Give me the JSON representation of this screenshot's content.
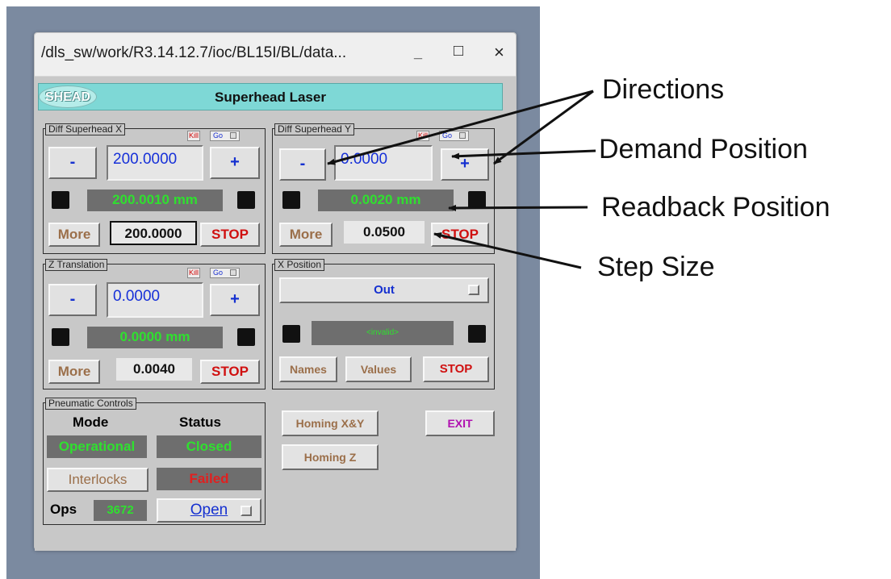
{
  "window": {
    "title": "/dls_sw/work/R3.14.12.7/ioc/BL15I/BL/data...",
    "minimize": "_",
    "maximize": "□",
    "close": "×"
  },
  "header": {
    "logo": "SHEAD",
    "title": "Superhead Laser"
  },
  "diff_x": {
    "label": "Diff Superhead X",
    "kill": "Kill",
    "go": "Go",
    "minus": "-",
    "plus": "+",
    "demand": "200.0000",
    "readback": "200.0010 mm",
    "more": "More",
    "step": "200.0000",
    "stop": "STOP"
  },
  "diff_y": {
    "label": "Diff Superhead Y",
    "kill": "Kill",
    "go": "Go",
    "minus": "-",
    "plus": "+",
    "demand": "0.0000",
    "readback": "0.0020 mm",
    "more": "More",
    "step": "0.0500",
    "stop": "STOP"
  },
  "z_trans": {
    "label": "Z Translation",
    "kill": "Kill",
    "go": "Go",
    "minus": "-",
    "plus": "+",
    "demand": "0.0000",
    "readback": "0.0000 mm",
    "more": "More",
    "step": "0.0040",
    "stop": "STOP"
  },
  "x_position": {
    "label": "X Position",
    "select": "Out",
    "readback": "<invalid>",
    "names": "Names",
    "values": "Values",
    "stop": "STOP"
  },
  "pneumatic": {
    "label": "Pneumatic Controls",
    "mode_header": "Mode",
    "status_header": "Status",
    "mode": "Operational",
    "status": "Closed",
    "interlocks": "Interlocks",
    "interlock_status": "Failed",
    "ops_label": "Ops",
    "ops": "3672",
    "open": "Open"
  },
  "actions": {
    "homing_xy": "Homing X&Y",
    "homing_z": "Homing Z",
    "exit": "EXIT"
  },
  "annotations": {
    "directions": "Directions",
    "demand": "Demand Position",
    "readback": "Readback Position",
    "step": "Step Size"
  },
  "colors": {
    "header_bg": "#7ed8d6",
    "readback_text": "#2fe02f",
    "demand_text": "#1630d8",
    "stop_text": "#d01010",
    "more_text": "#9b6f4a",
    "exit_text": "#b010b0"
  }
}
